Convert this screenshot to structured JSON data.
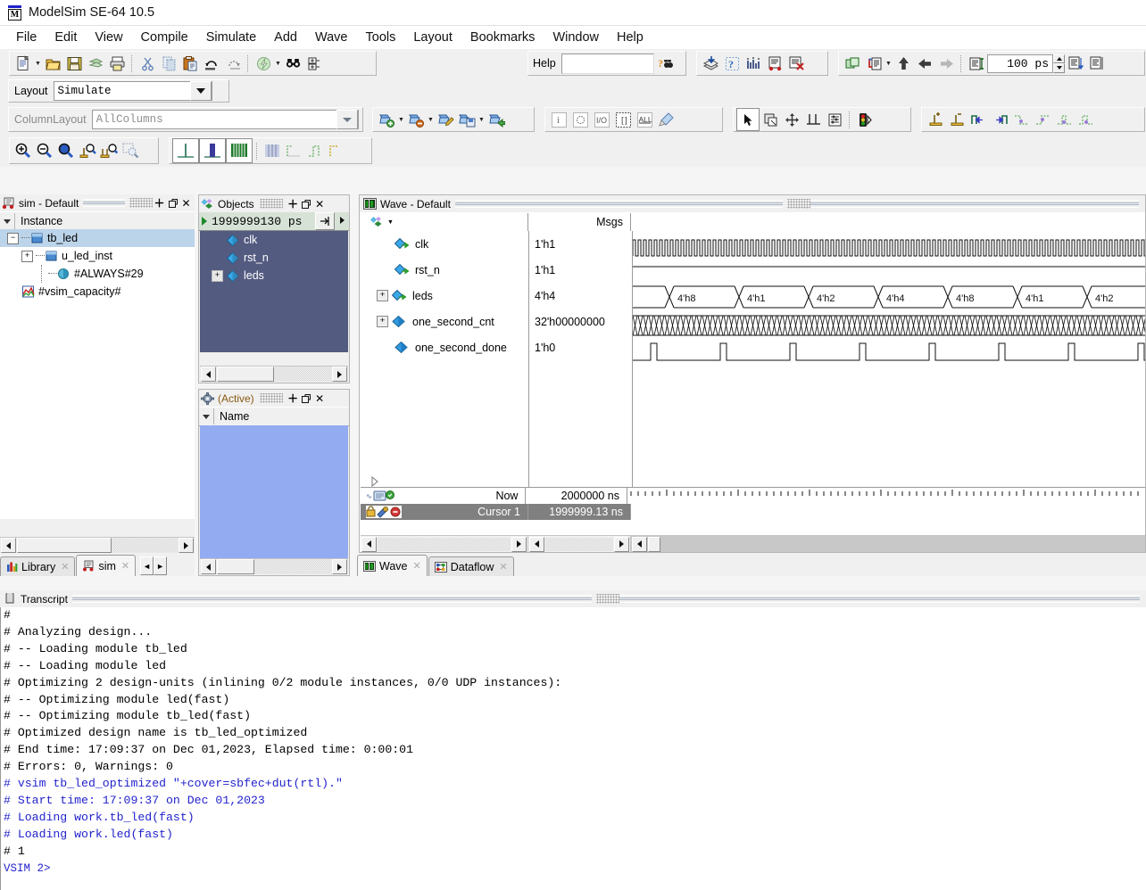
{
  "window": {
    "title": "ModelSim SE-64 10.5",
    "icon": "modelsim-logo-icon"
  },
  "menubar": {
    "items": [
      "File",
      "Edit",
      "View",
      "Compile",
      "Simulate",
      "Add",
      "Wave",
      "Tools",
      "Layout",
      "Bookmarks",
      "Window",
      "Help"
    ]
  },
  "toolbar_main": {
    "groups": [
      {
        "name": "file-group",
        "buttons": [
          "new-file-icon",
          "dropdown-caret",
          "open-folder-icon",
          "save-icon",
          "reload-icon",
          "print-icon",
          "separator",
          "cut-icon",
          "copy-icon",
          "paste-icon",
          "undo-icon",
          "redo-icon",
          "separator",
          "compile-icon",
          "dropdown-caret",
          "find-icon",
          "collapse-expand-icon"
        ]
      },
      {
        "name": "help-group",
        "buttons": [
          "help-search-field",
          "help-search-icon"
        ]
      },
      {
        "name": "simulate-group",
        "buttons": [
          "load-design-icon",
          "what-is-icon",
          "coverage-icon",
          "report-icon",
          "clear-icon"
        ]
      },
      {
        "name": "run-group",
        "buttons": [
          "sim-windows-icon",
          "step-icon",
          "dropdown-caret",
          "run-up-icon",
          "run-back-icon",
          "run-fwd-icon",
          "separator",
          "run-length-icon",
          "run-length-field",
          "spinner",
          "restart-icon",
          "continue-icon"
        ]
      }
    ],
    "help_label": "Help",
    "help_value": "",
    "run_length": "100 ps"
  },
  "layout_bar": {
    "label": "Layout",
    "value": "Simulate"
  },
  "columnlayout_bar": {
    "label": "ColumnLayout",
    "value": "AllColumns"
  },
  "toolbar_wave": {
    "zoom_buttons": [
      "zoom-in-icon",
      "zoom-out-icon",
      "zoom-full-icon",
      "zoom-cursor-icon",
      "zoom-range-icon",
      "zoom-mode-icon"
    ],
    "format_buttons": [
      "wave-single-icon",
      "wave-dual-icon",
      "wave-all-icon",
      "grid-dotted-icon",
      "edge-rise-icon",
      "edge-pulse-icon",
      "edge-fall-icon"
    ],
    "object_buttons": [
      "add-wave-icon",
      "remove-wave-icon",
      "edit-wave-icon",
      "save-wave-icon",
      "export-wave-icon"
    ],
    "filter_buttons": [
      "filter-input-icon",
      "filter-internal-icon",
      "filter-inout-icon",
      "filter-port-icon",
      "filter-all-icon",
      "filter-clear-icon"
    ],
    "tool_buttons": [
      "select-mode-icon",
      "zoom-mode-icon",
      "pan-mode-icon",
      "cursor-mode-icon",
      "edit-mode-icon",
      "breakpoint-icon"
    ],
    "cursor_buttons": [
      "insert-cursor-icon",
      "delete-cursor-icon",
      "prev-transition-icon",
      "next-transition-icon",
      "find-prev-falling-icon",
      "find-next-falling-icon",
      "find-prev-rising-icon",
      "find-next-rising-icon"
    ]
  },
  "sim_pane": {
    "title": "sim - Default",
    "icon": "sim-truck-icon",
    "column_header": "Instance",
    "tree": [
      {
        "label": "tb_led",
        "depth": 0,
        "expander": "-",
        "icon": "module-icon",
        "selected": true
      },
      {
        "label": "u_led_inst",
        "depth": 1,
        "expander": "+",
        "icon": "module-icon",
        "selected": false
      },
      {
        "label": "#ALWAYS#29",
        "depth": 2,
        "expander": "",
        "icon": "process-icon",
        "selected": false
      },
      {
        "label": "#vsim_capacity#",
        "depth": 1,
        "expander": "",
        "icon": "capacity-icon",
        "selected": false
      }
    ]
  },
  "objects_pane": {
    "title": "Objects",
    "icon": "objects-icon",
    "time_value": "1999999130  ps",
    "items": [
      {
        "label": "clk",
        "expander": "",
        "icon": "signal-diamond-icon"
      },
      {
        "label": "rst_n",
        "expander": "",
        "icon": "signal-diamond-icon"
      },
      {
        "label": "leds",
        "expander": "+",
        "icon": "signal-diamond-icon"
      }
    ]
  },
  "active_pane": {
    "title": "(Active)",
    "icon": "gear-icon",
    "column_header": "Name",
    "items": []
  },
  "wave_pane": {
    "title": "Wave - Default",
    "icon": "wave-icon",
    "msgs_header": "Msgs",
    "signals": [
      {
        "name": "clk",
        "value": "1'h1",
        "expander": "",
        "icon": "signal-green-arrow-icon",
        "wave": "clock"
      },
      {
        "name": "rst_n",
        "value": "1'h1",
        "expander": "",
        "icon": "signal-green-arrow-icon",
        "wave": "high"
      },
      {
        "name": "leds",
        "value": "4'h4",
        "expander": "+",
        "icon": "bus-green-arrow-icon",
        "wave": "bus"
      },
      {
        "name": "one_second_cnt",
        "value": "32'h00000000",
        "expander": "+",
        "icon": "bus-diamond-icon",
        "wave": "busfast"
      },
      {
        "name": "one_second_done",
        "value": "1'h0",
        "expander": "",
        "icon": "signal-diamond-icon",
        "wave": "pulse"
      }
    ],
    "bus_values": [
      "4'h8",
      "4'h1",
      "4'h2",
      "4'h4",
      "4'h8",
      "4'h1",
      "4'h2"
    ],
    "footer": {
      "now_label": "Now",
      "now_value": "2000000 ns",
      "cursor_label": "Cursor 1",
      "cursor_value": "1999999.13 ns",
      "now_icon": "now-icon",
      "cursor_icon": "cursor-lock-icon"
    }
  },
  "bottom_tabs_left": [
    {
      "label": "Library",
      "icon": "library-icon",
      "active": false
    },
    {
      "label": "sim",
      "icon": "sim-truck-icon",
      "active": true
    }
  ],
  "bottom_tabs_wave": [
    {
      "label": "Wave",
      "icon": "wave-icon",
      "active": true
    },
    {
      "label": "Dataflow",
      "icon": "dataflow-icon",
      "active": false
    }
  ],
  "transcript": {
    "title": "Transcript",
    "icon": "transcript-icon",
    "lines": [
      {
        "text": "# ",
        "color": "#000000"
      },
      {
        "text": "# Analyzing design...",
        "color": "#000000"
      },
      {
        "text": "# -- Loading module tb_led",
        "color": "#000000"
      },
      {
        "text": "# -- Loading module led",
        "color": "#000000"
      },
      {
        "text": "# Optimizing 2 design-units (inlining 0/2 module instances, 0/0 UDP instances):",
        "color": "#000000"
      },
      {
        "text": "# -- Optimizing module led(fast)",
        "color": "#000000"
      },
      {
        "text": "# -- Optimizing module tb_led(fast)",
        "color": "#000000"
      },
      {
        "text": "# Optimized design name is tb_led_optimized",
        "color": "#000000"
      },
      {
        "text": "# End time: 17:09:37 on Dec 01,2023, Elapsed time: 0:00:01",
        "color": "#000000"
      },
      {
        "text": "# Errors: 0, Warnings: 0",
        "color": "#000000"
      },
      {
        "text": "# vsim tb_led_optimized \"+cover=sbfec+dut(rtl).\"",
        "color": "#2222cc"
      },
      {
        "text": "# Start time: 17:09:37 on Dec 01,2023",
        "color": "#2222cc"
      },
      {
        "text": "# Loading work.tb_led(fast)",
        "color": "#2222cc"
      },
      {
        "text": "# Loading work.led(fast)",
        "color": "#2222cc"
      },
      {
        "text": "# 1",
        "color": "#000000"
      },
      {
        "text": "",
        "color": "#000000"
      },
      {
        "text": "VSIM 2>",
        "color": "#2222cc"
      }
    ]
  },
  "colors": {
    "objects_bg": "#545b80",
    "active_bg": "#93abf0",
    "selection": "#bcd4ea",
    "toolbar_bg": "#f0f0f0",
    "time_bar_bg": "#d7e2d7",
    "cursor_row_bg": "#808080",
    "transcript_blue": "#2222cc"
  }
}
